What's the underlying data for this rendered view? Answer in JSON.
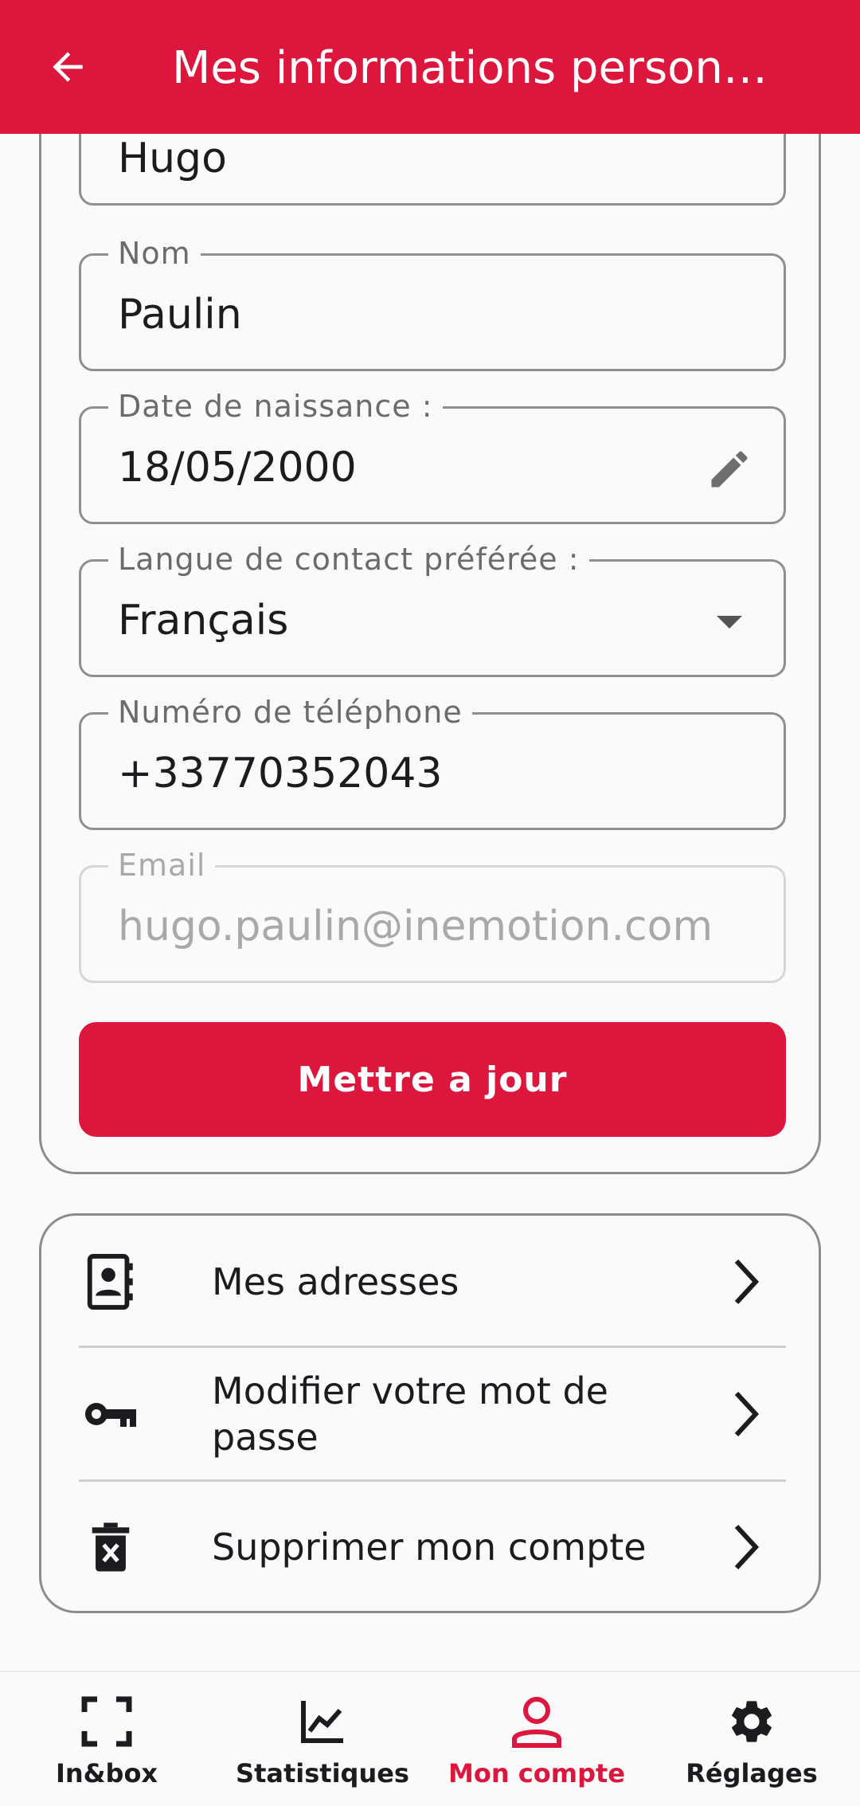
{
  "app_bar": {
    "title": "Mes informations person…"
  },
  "form": {
    "first_name": {
      "value": "Hugo"
    },
    "last_name": {
      "label": "Nom",
      "value": "Paulin"
    },
    "birth_date": {
      "label": "Date de naissance :",
      "value": "18/05/2000"
    },
    "language": {
      "label": "Langue de contact préférée :",
      "value": "Français"
    },
    "phone": {
      "label": "Numéro de téléphone",
      "value": "+33770352043"
    },
    "email": {
      "label": "Email",
      "value": "hugo.paulin@inemotion.com",
      "disabled": true
    },
    "update_button": "Mettre a jour"
  },
  "menu": {
    "items": [
      {
        "label": "Mes adresses",
        "icon": "contacts-icon"
      },
      {
        "label": "Modifier votre mot de passe",
        "icon": "key-icon"
      },
      {
        "label": "Supprimer mon compte",
        "icon": "delete-icon"
      }
    ]
  },
  "bottom_nav": {
    "items": [
      {
        "label": "In&box",
        "icon": "scan-frame-icon",
        "active": false
      },
      {
        "label": "Statistiques",
        "icon": "chart-icon",
        "active": false
      },
      {
        "label": "Mon compte",
        "icon": "person-icon",
        "active": true
      },
      {
        "label": "Réglages",
        "icon": "gear-icon",
        "active": false
      }
    ]
  },
  "colors": {
    "brand": "#dc163d",
    "text": "#1c1b1f",
    "border": "#8f8f8f"
  }
}
